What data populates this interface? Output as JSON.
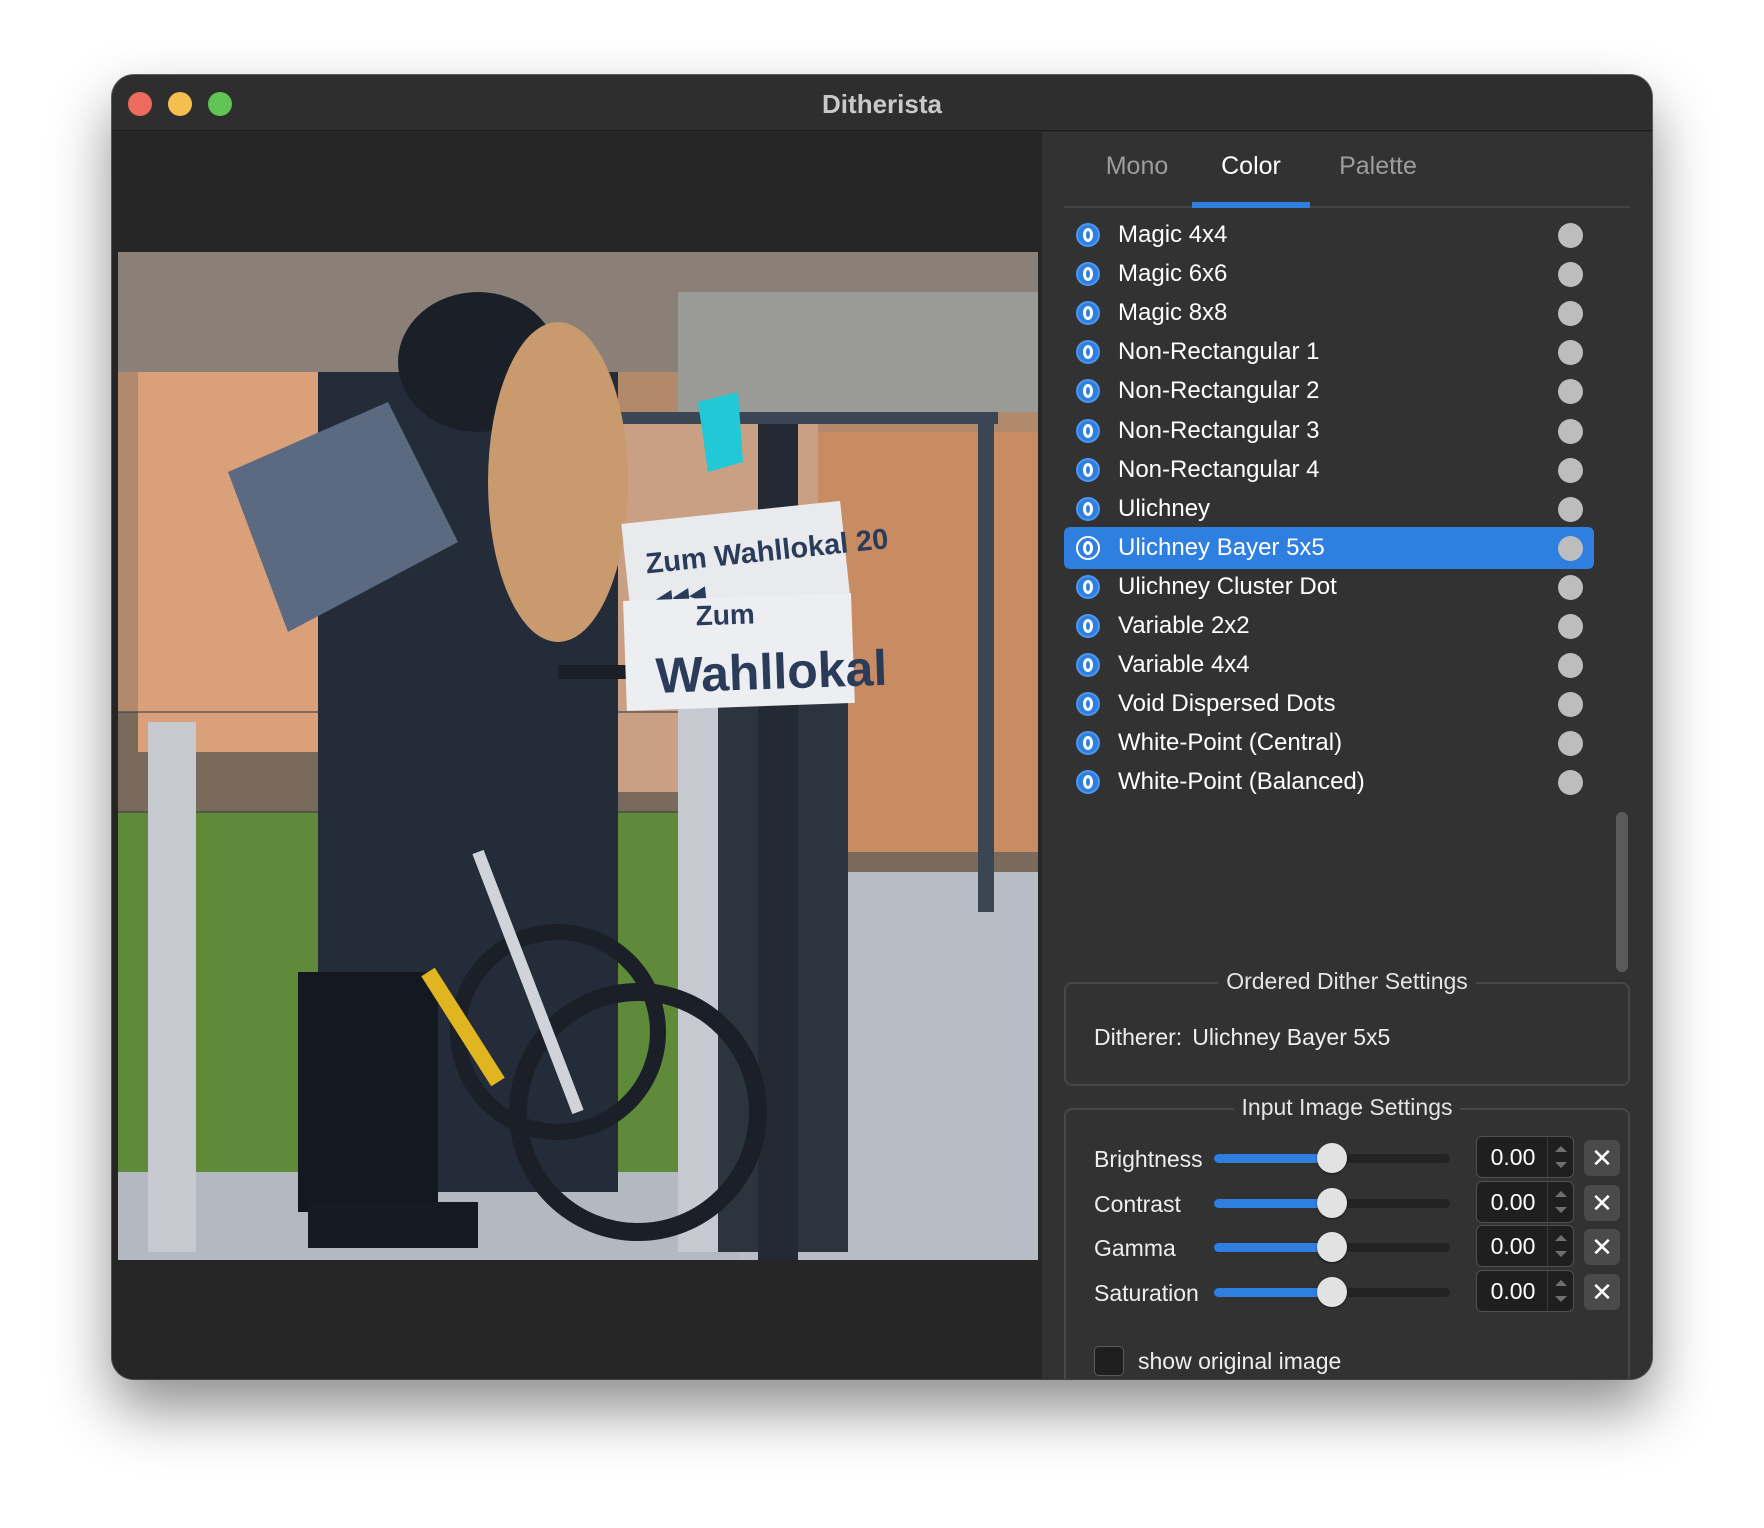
{
  "window": {
    "title": "Ditherista"
  },
  "tabs": [
    {
      "label": "Mono",
      "active": false
    },
    {
      "label": "Color",
      "active": true
    },
    {
      "label": "Palette",
      "active": false
    }
  ],
  "ditherers": [
    {
      "label": "Magic 4x4"
    },
    {
      "label": "Magic 6x6"
    },
    {
      "label": "Magic 8x8"
    },
    {
      "label": "Non-Rectangular 1"
    },
    {
      "label": "Non-Rectangular 2"
    },
    {
      "label": "Non-Rectangular 3"
    },
    {
      "label": "Non-Rectangular 4"
    },
    {
      "label": "Ulichney"
    },
    {
      "label": "Ulichney Bayer 5x5",
      "selected": true
    },
    {
      "label": "Ulichney Cluster Dot"
    },
    {
      "label": "Variable 2x2"
    },
    {
      "label": "Variable 4x4"
    },
    {
      "label": "Void Dispersed Dots"
    },
    {
      "label": "White-Point (Central)"
    },
    {
      "label": "White-Point (Balanced)"
    }
  ],
  "ordered_settings": {
    "title": "Ordered Dither Settings",
    "ditherer_label": "Ditherer:",
    "ditherer_value": "Ulichney Bayer 5x5"
  },
  "input_settings": {
    "title": "Input Image Settings",
    "sliders": [
      {
        "label": "Brightness",
        "value": "0.00",
        "level": 0.5
      },
      {
        "label": "Contrast",
        "value": "0.00",
        "level": 0.5
      },
      {
        "label": "Gamma",
        "value": "0.00",
        "level": 0.5
      },
      {
        "label": "Saturation",
        "value": "0.00",
        "level": 0.5
      }
    ],
    "reset_symbol": "✕",
    "show_original_label": "show original image",
    "show_original_checked": false
  },
  "photo_text": {
    "sign_line1": "Zum Wahllokal 20",
    "sign_arrows": "◀◀◀",
    "sign_line2": "Zum",
    "sign_line3": "Wahllokal"
  },
  "colors": {
    "accent": "#2f7fe0",
    "window_bg": "#2b2b2b",
    "panel_bg": "#323232"
  }
}
